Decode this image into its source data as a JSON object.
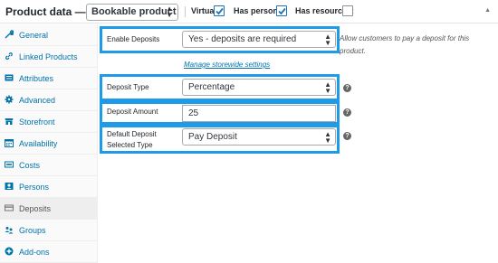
{
  "header": {
    "title": "Product data —",
    "product_type": "Bookable product",
    "virtual_label": "Virtual:",
    "virtual_checked": true,
    "persons_label": "Has persons:",
    "persons_checked": true,
    "resources_label": "Has resources:",
    "resources_checked": false
  },
  "sidebar": {
    "items": [
      {
        "label": "General",
        "icon": "wrench-icon"
      },
      {
        "label": "Linked Products",
        "icon": "link-icon"
      },
      {
        "label": "Attributes",
        "icon": "list-icon"
      },
      {
        "label": "Advanced",
        "icon": "gear-icon"
      },
      {
        "label": "Storefront",
        "icon": "storefront-icon"
      },
      {
        "label": "Availability",
        "icon": "calendar-icon"
      },
      {
        "label": "Costs",
        "icon": "money-icon"
      },
      {
        "label": "Persons",
        "icon": "persons-icon"
      },
      {
        "label": "Deposits",
        "icon": "card-icon"
      },
      {
        "label": "Groups",
        "icon": "groups-icon"
      },
      {
        "label": "Add-ons",
        "icon": "plus-circle-icon"
      }
    ],
    "active_index": 8
  },
  "form": {
    "enable_deposits": {
      "label": "Enable Deposits",
      "value": "Yes - deposits are required",
      "description": "Allow customers to pay a deposit for this product.",
      "link": "Manage storewide settings"
    },
    "deposit_type": {
      "label": "Deposit Type",
      "value": "Percentage"
    },
    "deposit_amount": {
      "label": "Deposit Amount",
      "value": "25"
    },
    "default_deposit": {
      "label": "Default Deposit Selected Type",
      "value": "Pay Deposit"
    },
    "help_glyph": "?"
  },
  "colors": {
    "highlight": "#1e9be8",
    "link": "#0073aa"
  }
}
